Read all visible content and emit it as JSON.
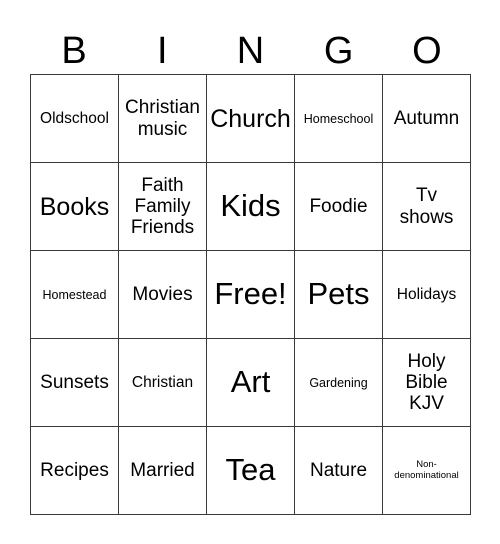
{
  "card": {
    "header_letters": [
      "B",
      "I",
      "N",
      "G",
      "O"
    ],
    "free_space_label": "Free!",
    "colors": {
      "background": "#ffffff",
      "border": "#3a3a3a",
      "text": "#000000"
    },
    "grid": {
      "columns": 5,
      "rows": 5,
      "cells": [
        {
          "label": "Oldschool",
          "size": "sm"
        },
        {
          "label": "Christian\nmusic",
          "size": "md"
        },
        {
          "label": "Church",
          "size": "lg"
        },
        {
          "label": "Homeschool",
          "size": "xs"
        },
        {
          "label": "Autumn",
          "size": "md"
        },
        {
          "label": "Books",
          "size": "lg"
        },
        {
          "label": "Faith\nFamily\nFriends",
          "size": "md"
        },
        {
          "label": "Kids",
          "size": "xl"
        },
        {
          "label": "Foodie",
          "size": "md"
        },
        {
          "label": "Tv\nshows",
          "size": "md"
        },
        {
          "label": "Homestead",
          "size": "xs"
        },
        {
          "label": "Movies",
          "size": "md"
        },
        {
          "label": "Free!",
          "size": "xl"
        },
        {
          "label": "Pets",
          "size": "xl"
        },
        {
          "label": "Holidays",
          "size": "sm"
        },
        {
          "label": "Sunsets",
          "size": "md"
        },
        {
          "label": "Christian",
          "size": "sm"
        },
        {
          "label": "Art",
          "size": "xl"
        },
        {
          "label": "Gardening",
          "size": "xs"
        },
        {
          "label": "Holy\nBible\nKJV",
          "size": "md"
        },
        {
          "label": "Recipes",
          "size": "md"
        },
        {
          "label": "Married",
          "size": "md"
        },
        {
          "label": "Tea",
          "size": "xl"
        },
        {
          "label": "Nature",
          "size": "md"
        },
        {
          "label": "Non-\ndenominational",
          "size": "xxs"
        }
      ]
    }
  }
}
